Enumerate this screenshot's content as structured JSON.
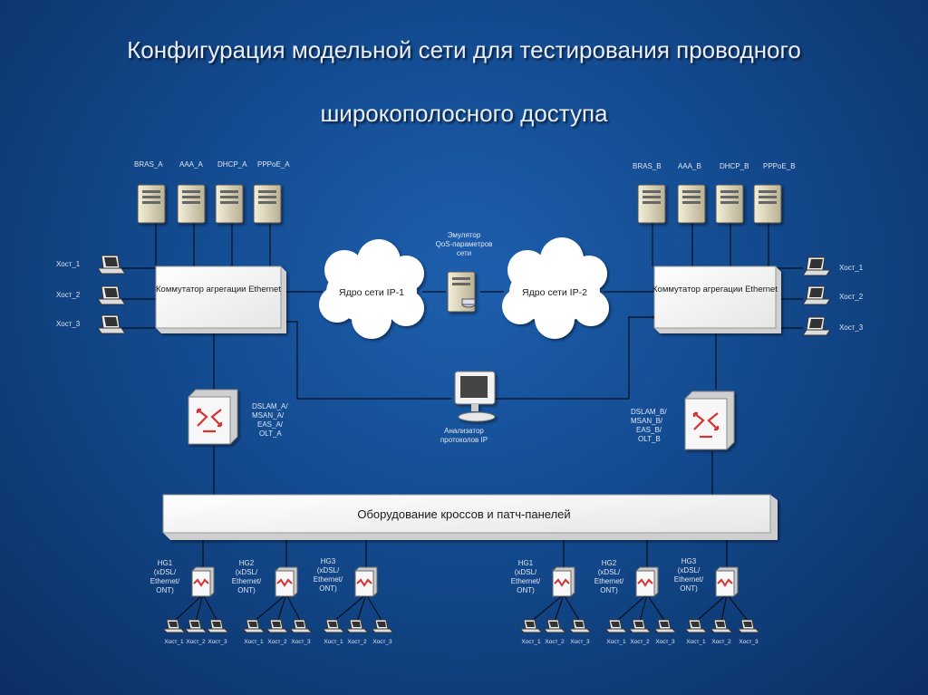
{
  "title_line1": "Конфигурация модельной сети для тестирования проводного",
  "title_line2": "широкополосного доступа",
  "servers_a": [
    "BRAS_A",
    "AAA_A",
    "DHCP_A",
    "PPPoE_A"
  ],
  "servers_b": [
    "BRAS_B",
    "AAA_B",
    "DHCP_B",
    "PPPoE_B"
  ],
  "switch_a": "Коммутатор агрегации Ethernet",
  "switch_b": "Коммутатор агрегации Ethernet",
  "hosts_left": [
    "Хост_1",
    "Хост_2",
    "Хост_3"
  ],
  "hosts_right": [
    "Хост_1",
    "Хост_2",
    "Хост_3"
  ],
  "core1": "Ядро сети IP-1",
  "core2": "Ядро сети IP-2",
  "emulator": [
    "Эмулятор",
    "QoS-параметров",
    "сети"
  ],
  "analyzer": [
    "Анализатор",
    "протоколов IP"
  ],
  "dslam_a": [
    "DSLAM_A/",
    "MSAN_A/",
    "EAS_A/",
    "OLT_A"
  ],
  "dslam_b": [
    "DSLAM_B/",
    "MSAN_B/",
    "EAS_B/",
    "OLT_B"
  ],
  "cross_panel": "Оборудование кроссов и патч-панелей",
  "hg_labels": [
    [
      "HG1",
      "(xDSL/",
      "Ethernet/",
      "ONT)"
    ],
    [
      "HG2",
      "(xDSL/",
      "Ethernet/",
      "ONT)"
    ],
    [
      "HG3",
      "(xDSL/",
      "Ethernet/",
      "ONT)"
    ],
    [
      "HG1",
      "(xDSL/",
      "Ethernet/",
      "ONT)"
    ],
    [
      "HG2",
      "(xDSL/",
      "Ethernet/",
      "ONT)"
    ],
    [
      "HG3",
      "(xDSL/",
      "Ethernet/",
      "ONT)"
    ]
  ],
  "bottom_host_labels": [
    "Хост_1",
    "Хост_2",
    "Хост_3"
  ],
  "colors": {
    "background": "#134a8e",
    "line": "#0a0f1c",
    "box": "#ffffff",
    "router": "#d63030"
  }
}
